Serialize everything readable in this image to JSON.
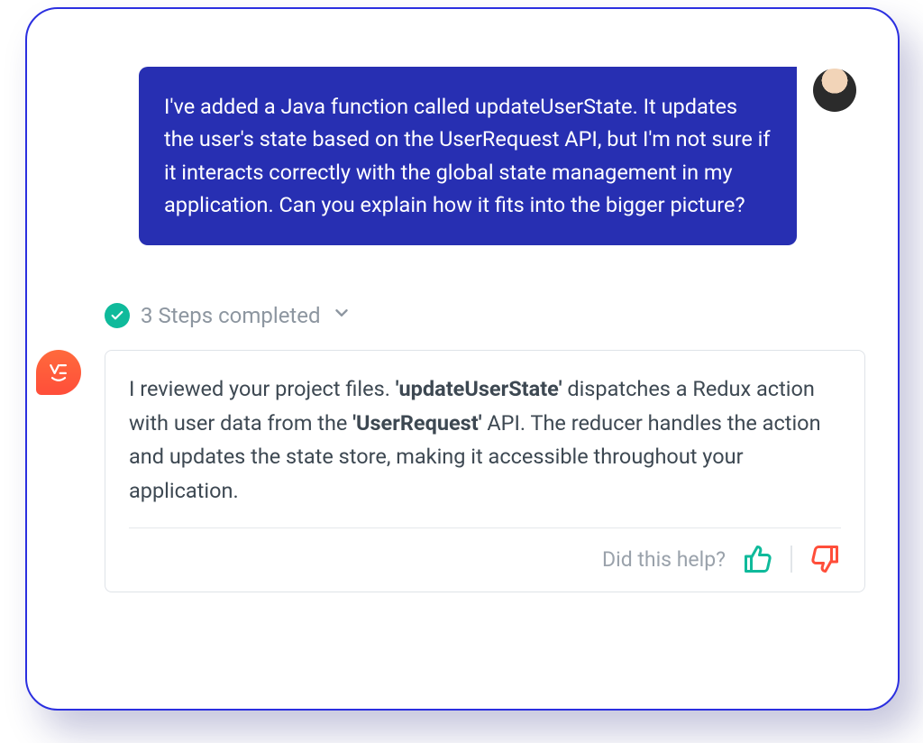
{
  "user_message": "I've added a Java function called updateUserState. It updates the user's state based on the UserRequest API, but I'm not sure if it interacts correctly with the global state management in my application. Can you explain how it fits into the bigger picture?",
  "steps": {
    "label": "3 Steps completed"
  },
  "ai_response": {
    "prefix": "I reviewed your project files. ",
    "bold1": "'updateUserState'",
    "mid1": " dispatches a Redux action with user data from the ",
    "bold2": "'UserRequest'",
    "suffix": " API. The reducer handles the action and updates the state store, making it accessible throughout your application."
  },
  "feedback": {
    "prompt": "Did this help?"
  }
}
